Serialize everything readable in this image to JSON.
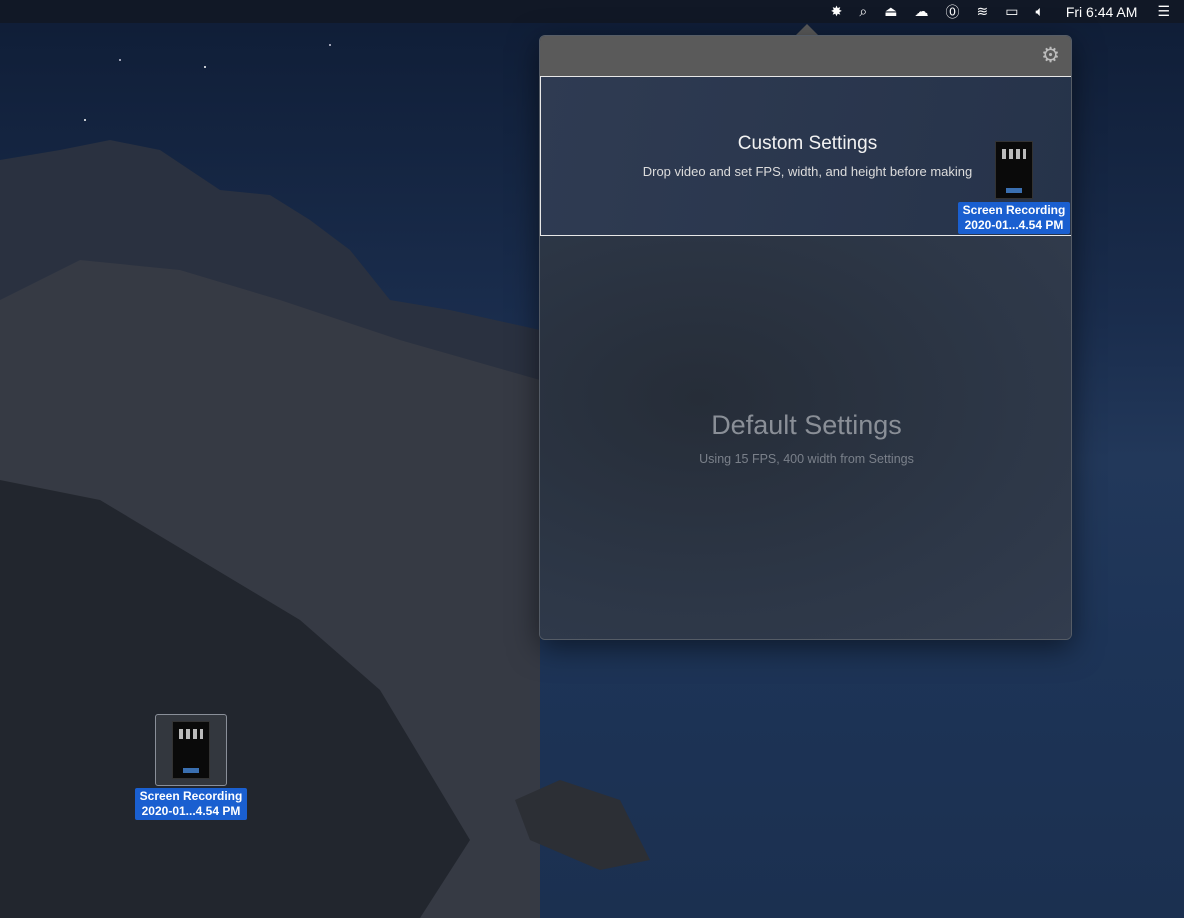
{
  "menubar": {
    "icons": [
      "app-burst-icon",
      "spotlight-search-icon",
      "eject-icon",
      "cloud-app-icon",
      "password-manager-icon",
      "wifi-icon",
      "airplay-icon",
      "volume-icon"
    ],
    "clock": "Fri 6:44 AM",
    "notification_icon": "list-icon"
  },
  "popover": {
    "settings_icon": "gear-icon",
    "custom": {
      "title": "Custom Settings",
      "subtitle": "Drop video and set FPS, width, and height before making"
    },
    "default": {
      "title": "Default Settings",
      "subtitle": "Using 15 FPS, 400 width from Settings"
    }
  },
  "dragged_file": {
    "name_line1": "Screen Recording",
    "name_line2": "2020-01...4.54 PM"
  },
  "desktop_file": {
    "name_line1": "Screen Recording",
    "name_line2": "2020-01...4.54 PM"
  }
}
